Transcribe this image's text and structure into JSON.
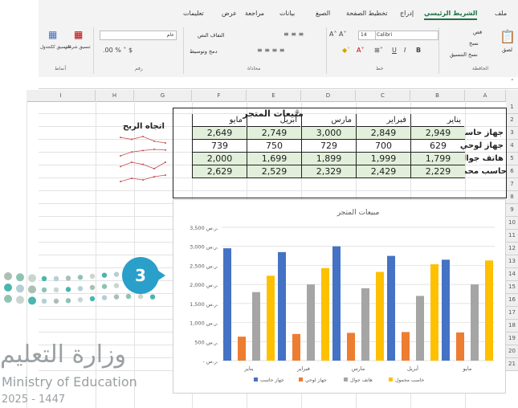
{
  "ribbon": {
    "tabs": [
      "ملف",
      "الشريط الرئيسي",
      "إدراج",
      "تخطيط الصفحة",
      "الصيغ",
      "بيانات",
      "مراجعة",
      "عرض",
      "تعليمات"
    ],
    "active_tab": "الشريط الرئيسي",
    "font_name": "Calibri",
    "font_size": "14",
    "paste_label": "لصق",
    "cut_label": "قص",
    "copy_label": "نسخ",
    "format_painter_label": "نسخ التنسيق",
    "wrap_text_label": "التفاف النص",
    "merge_label": "دمج وتوسيط",
    "number_format": "عام",
    "conditional_format_label": "تنسيق شرطي",
    "table_format_label": "التنسيق ككجدول",
    "groups": [
      "الحافظة",
      "خط",
      "محاذاة",
      "رقم",
      "أنماط"
    ]
  },
  "sheet": {
    "columns": [
      "A",
      "B",
      "C",
      "D",
      "E",
      "F",
      "G",
      "H",
      "I"
    ],
    "rows": [
      "1",
      "2",
      "3",
      "4",
      "5",
      "6",
      "7",
      "8",
      "9",
      "10",
      "11",
      "12",
      "13",
      "14",
      "15",
      "16",
      "17",
      "18",
      "19",
      "20",
      "21"
    ],
    "title": "مبيعات المتجر",
    "months": [
      "يناير",
      "فبراير",
      "مارس",
      "أبريل",
      "مايو"
    ],
    "trend_header": "اتجاه الربح",
    "products": [
      {
        "name": "جهاز حاسب",
        "values": [
          "2,949",
          "2,849",
          "3,000",
          "2,749",
          "2,649"
        ]
      },
      {
        "name": "جهاز لوحي",
        "values": [
          "629",
          "700",
          "729",
          "750",
          "739"
        ]
      },
      {
        "name": "هاتف جوال",
        "values": [
          "1,799",
          "1,999",
          "1,899",
          "1,699",
          "2,000"
        ]
      },
      {
        "name": "حاسب محمول",
        "values": [
          "2,229",
          "2,429",
          "2,329",
          "2,529",
          "2,629"
        ]
      }
    ]
  },
  "chart_data": {
    "type": "bar",
    "title": "مبيعات المتجر",
    "categories": [
      "يناير",
      "فبراير",
      "مارس",
      "أبريل",
      "مايو"
    ],
    "series": [
      {
        "name": "جهاز حاسب",
        "values": [
          2949,
          2849,
          3000,
          2749,
          2649
        ],
        "color": "#4472c4"
      },
      {
        "name": "جهاز لوحي",
        "values": [
          629,
          700,
          729,
          750,
          739
        ],
        "color": "#ed7d31"
      },
      {
        "name": "هاتف جوال",
        "values": [
          1799,
          1999,
          1899,
          1699,
          2000
        ],
        "color": "#a5a5a5"
      },
      {
        "name": "حاسب محمول",
        "values": [
          2229,
          2429,
          2329,
          2529,
          2629
        ],
        "color": "#ffc000"
      }
    ],
    "y_ticks": [
      "3,500 ر.س.",
      "3,000 ر.س.",
      "2,500 ر.س.",
      "2,000 ر.س.",
      "1,500 ر.س.",
      "1,000 ر.س.",
      "500 ر.س.",
      "- ر.س."
    ],
    "ylim": [
      0,
      3500
    ],
    "grid": true,
    "legend": "bottom"
  },
  "overlay": {
    "badge": "3",
    "ministry_ar": "وزارة التعليم",
    "ministry_en": "Ministry of Education",
    "year": "2025 - 1447"
  }
}
